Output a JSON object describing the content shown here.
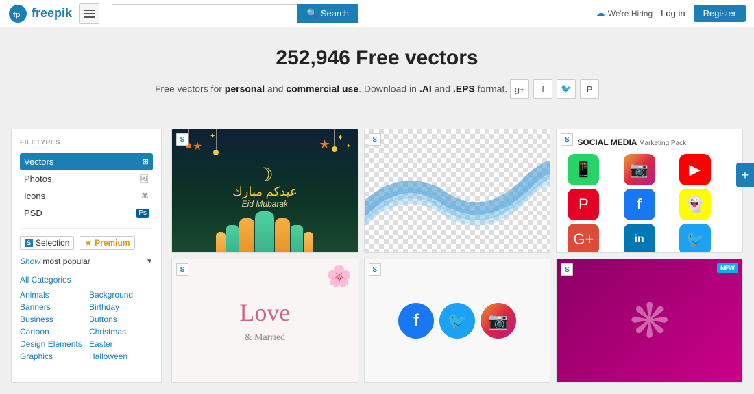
{
  "header": {
    "logo_text": "freepik",
    "hamburger_label": "menu",
    "search_placeholder": "",
    "search_button_label": "Search",
    "hiring_text": "We're Hiring",
    "login_label": "Log in",
    "register_label": "Register"
  },
  "hero": {
    "title": "252,946 Free vectors",
    "subtitle_part1": "Free vectors for ",
    "bold1": "personal",
    "subtitle_part2": " and ",
    "bold2": "commercial use",
    "subtitle_part3": ". Download in ",
    "bold3": ".AI",
    "subtitle_part4": " and ",
    "bold4": ".EPS",
    "subtitle_part5": " format.",
    "social": {
      "google_label": "g+",
      "facebook_label": "f",
      "twitter_label": "t",
      "pinterest_label": "p"
    }
  },
  "sidebar": {
    "filetypes_title": "FILETYPES",
    "filetypes": [
      {
        "label": "Vectors",
        "icon": "⊞",
        "active": true
      },
      {
        "label": "Photos",
        "icon": "🖼",
        "active": false
      },
      {
        "label": "Icons",
        "icon": "⌘",
        "active": false
      },
      {
        "label": "PSD",
        "icon": "Ps",
        "active": false
      }
    ],
    "selection_label": "Selection",
    "s_badge": "S",
    "premium_label": "Premium",
    "show_most_popular_show": "Show",
    "show_most_popular_rest": "most popular",
    "categories": {
      "all": "All Categories",
      "col1": [
        "Animals",
        "Banners",
        "Business",
        "Cartoon",
        "Design Elements",
        "Graphics"
      ],
      "col2": [
        "Background",
        "Birthday",
        "Buttons",
        "Christmas",
        "Easter",
        "Halloween"
      ]
    }
  },
  "cards": [
    {
      "id": "eid",
      "s_badge": "S",
      "type": "eid"
    },
    {
      "id": "waves",
      "s_badge": "S",
      "type": "waves"
    },
    {
      "id": "social",
      "s_badge": "S",
      "type": "social",
      "header": "SOCIAL MEDIA",
      "sub": "Marketing Pack"
    },
    {
      "id": "love",
      "s_badge": "S",
      "type": "love"
    },
    {
      "id": "social2",
      "s_badge": "S",
      "type": "social2"
    },
    {
      "id": "ornate",
      "s_badge": "S",
      "type": "ornate",
      "badge": "NEW"
    }
  ],
  "floating_plus": "+"
}
